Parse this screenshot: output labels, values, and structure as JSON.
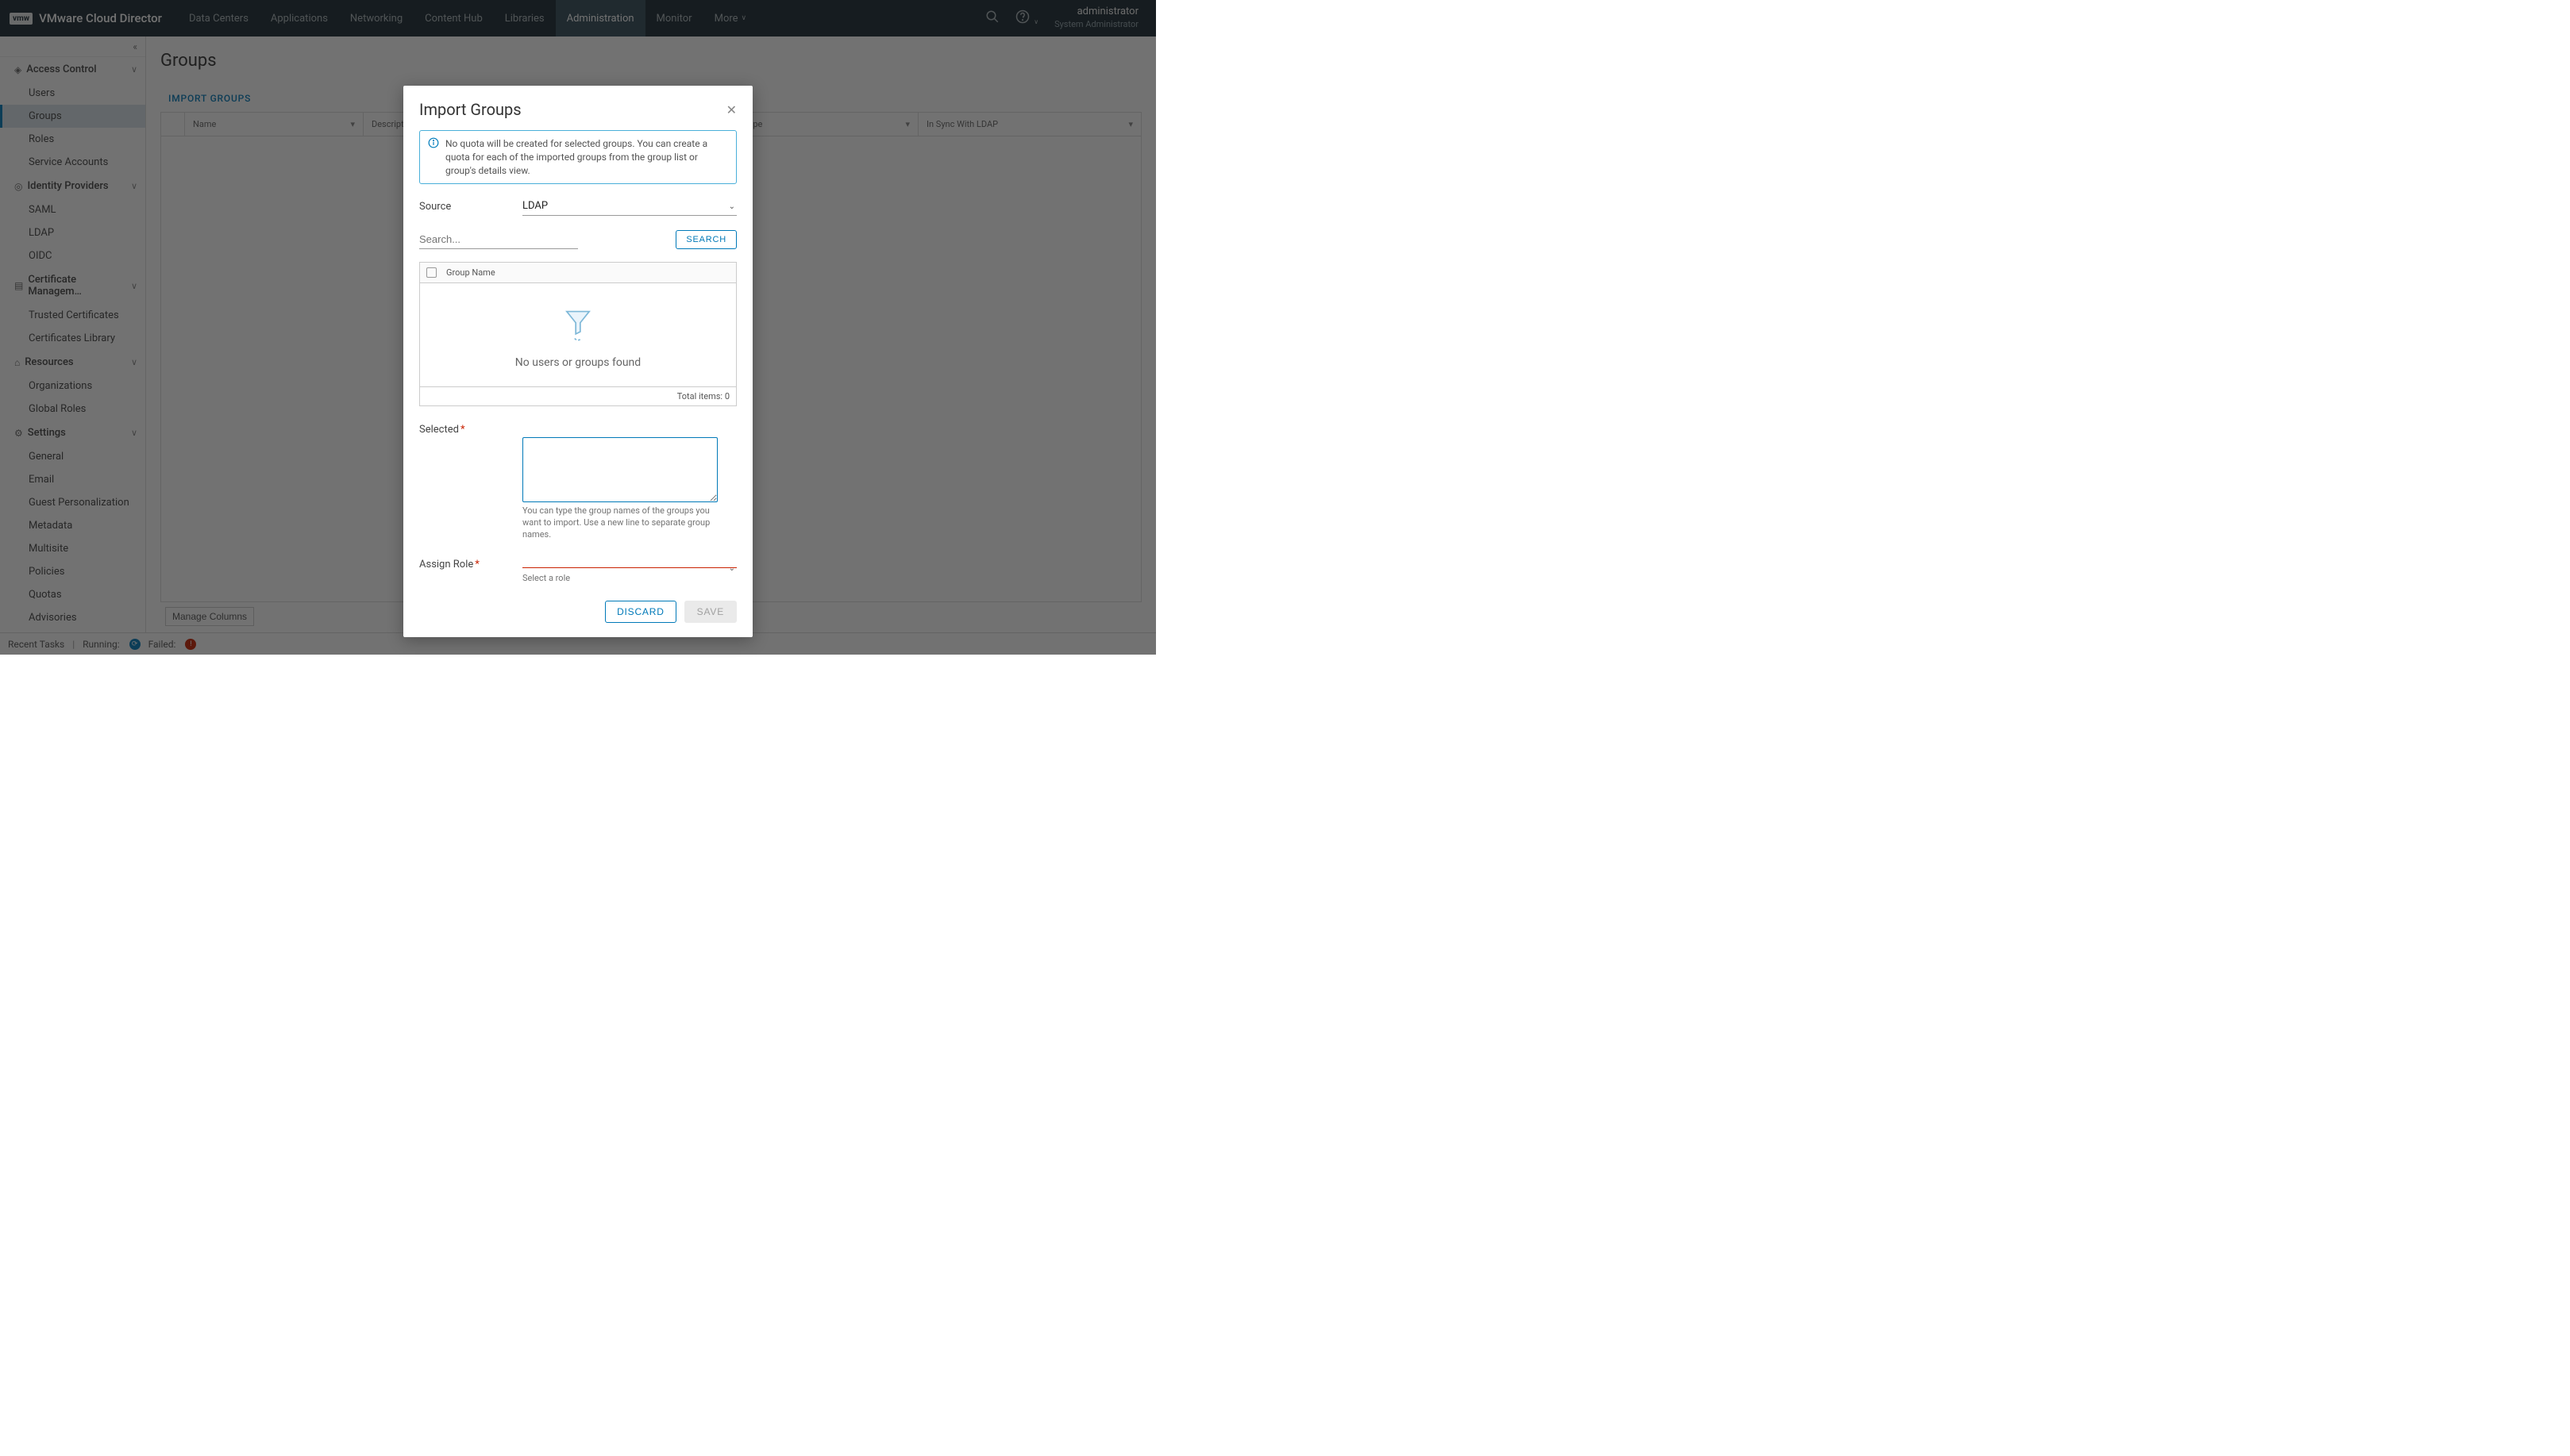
{
  "header": {
    "brand_short": "vmw",
    "brand_title": "VMware Cloud Director",
    "nav": [
      "Data Centers",
      "Applications",
      "Networking",
      "Content Hub",
      "Libraries",
      "Administration",
      "Monitor",
      "More"
    ],
    "active_nav": "Administration",
    "user_name": "administrator",
    "user_role": "System Administrator"
  },
  "sidebar": {
    "sections": [
      {
        "label": "Access Control",
        "items": [
          "Users",
          "Groups",
          "Roles",
          "Service Accounts"
        ],
        "active_item": "Groups"
      },
      {
        "label": "Identity Providers",
        "items": [
          "SAML",
          "LDAP",
          "OIDC"
        ]
      },
      {
        "label": "Certificate Managem…",
        "items": [
          "Trusted Certificates",
          "Certificates Library"
        ]
      },
      {
        "label": "Resources",
        "items": [
          "Organizations",
          "Global Roles"
        ]
      },
      {
        "label": "Settings",
        "items": [
          "General",
          "Email",
          "Guest Personalization",
          "Metadata",
          "Multisite",
          "Policies",
          "Quotas",
          "Advisories"
        ]
      }
    ]
  },
  "main": {
    "title": "Groups",
    "import_link": "IMPORT GROUPS",
    "columns": [
      "Name",
      "Description",
      "",
      "Type",
      "In Sync With LDAP"
    ],
    "manage_columns": "Manage Columns"
  },
  "status": {
    "label": "Recent Tasks",
    "running": "Running:",
    "failed": "Failed:"
  },
  "dialog": {
    "title": "Import Groups",
    "info": "No quota will be created for selected groups. You can create a quota for each of the imported groups from the group list or group's details view.",
    "source_label": "Source",
    "source_value": "LDAP",
    "search_placeholder": "Search...",
    "search_btn": "SEARCH",
    "group_name_col": "Group Name",
    "empty_msg": "No users or groups found",
    "total_items_label": "Total items: 0",
    "selected_label": "Selected",
    "selected_helper": "You can type the group names of the groups you want to import. Use a new line to separate group names.",
    "assign_role_label": "Assign Role",
    "role_helper": "Select a role",
    "discard": "DISCARD",
    "save": "SAVE"
  }
}
